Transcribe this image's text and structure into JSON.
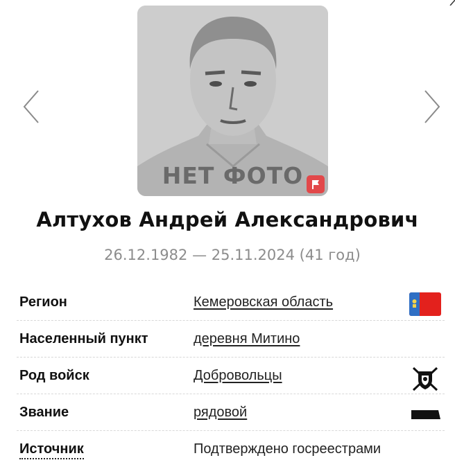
{
  "photo": {
    "placeholder_text": "НЕТ ФОТО",
    "flag_icon": "flag-icon"
  },
  "navigation": {
    "prev_icon": "chevron-left-icon",
    "next_icon": "chevron-right-icon"
  },
  "person": {
    "name": "Алтухов Андрей Александрович",
    "dates": "26.12.1982 — 25.11.2024 (41 год)"
  },
  "details": [
    {
      "label": "Регион",
      "value": "Кемеровская область",
      "icon": "region-flag-icon"
    },
    {
      "label": "Населенный пункт",
      "value": "деревня Митино"
    },
    {
      "label": "Род войск",
      "value": "Добровольцы",
      "icon": "volunteers-emblem-icon"
    },
    {
      "label": "Звание",
      "value": "рядовой",
      "icon": "rank-insignia-icon"
    },
    {
      "label": "Источник",
      "value": "Подтверждено госреестрами"
    }
  ],
  "colors": {
    "region_flag_blue": "#2f6fc4",
    "region_flag_red": "#e3211d",
    "badge_red": "#e2484a",
    "muted_text": "#8c8c8c"
  }
}
